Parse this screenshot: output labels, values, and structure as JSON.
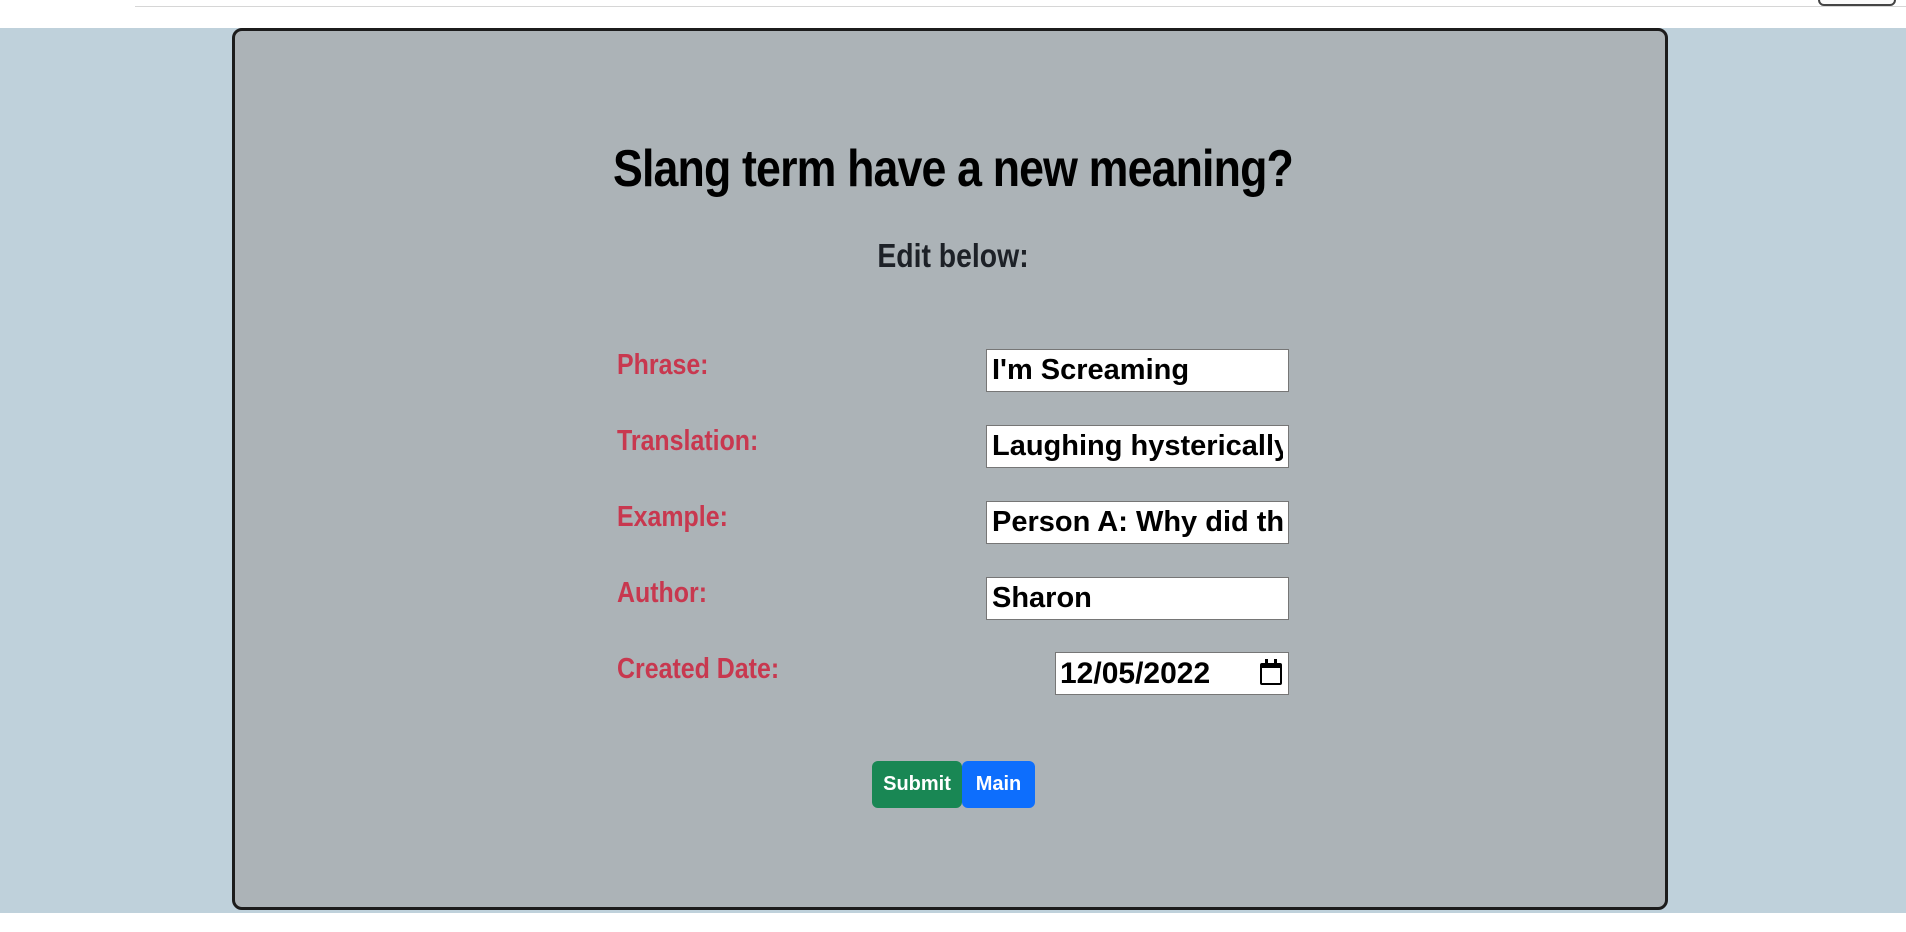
{
  "page": {
    "heading": "Slang term have a new meaning?",
    "subheading": "Edit below:"
  },
  "form": {
    "phrase": {
      "label": "Phrase:",
      "value": "I'm Screaming"
    },
    "translation": {
      "label": "Translation:",
      "value": "Laughing hysterically."
    },
    "example": {
      "label": "Example:",
      "value": "Person A: Why did the pr"
    },
    "author": {
      "label": "Author:",
      "value": "Sharon"
    },
    "created_date": {
      "label": "Created Date:",
      "value": "12/05/2022",
      "icon": "calendar-icon"
    }
  },
  "buttons": {
    "submit_label": "Submit",
    "main_label": "Main"
  },
  "colors": {
    "page_background": "#bfd1db",
    "card_background": "#acb3b7",
    "label_color": "#c8384f",
    "submit_color": "#198754",
    "main_color": "#0d6efd"
  }
}
